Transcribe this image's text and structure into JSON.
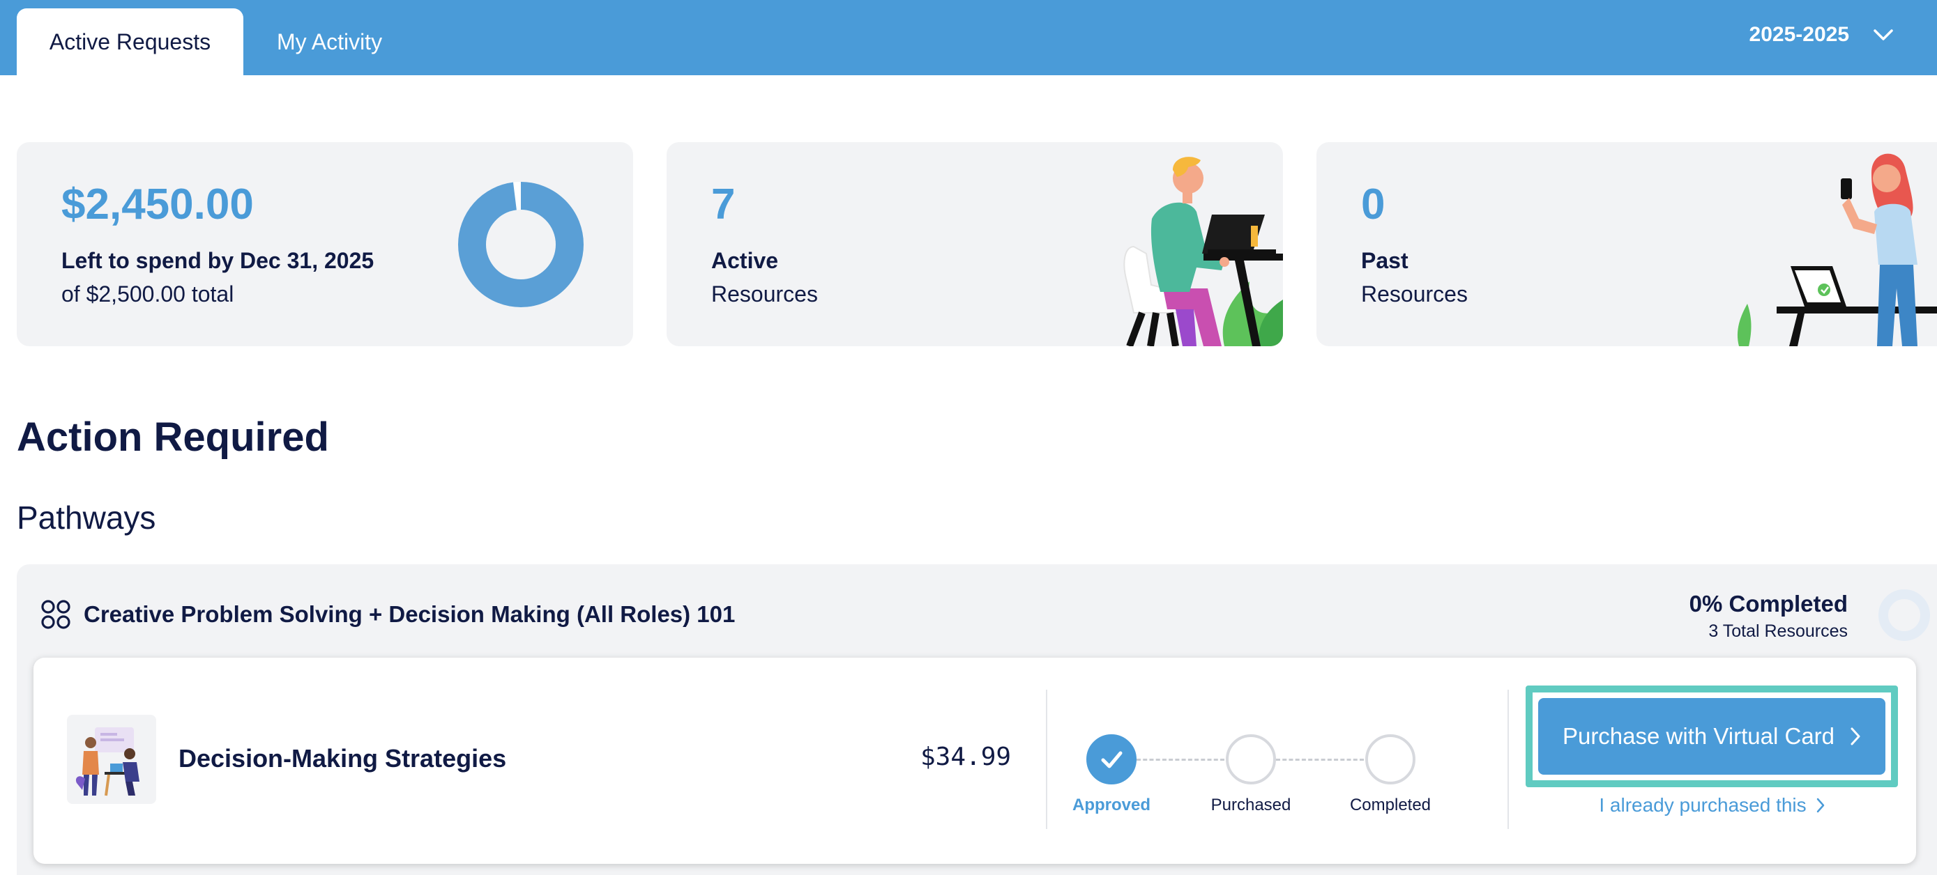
{
  "tabs": [
    {
      "label": "Active Requests",
      "active": true
    },
    {
      "label": "My Activity",
      "active": false
    }
  ],
  "year_select": {
    "value": "2025-2025",
    "icon": "chevron-down-icon"
  },
  "stats": {
    "budget": {
      "amount": "$2,450.00",
      "label": "Left to spend by Dec 31, 2025",
      "sublabel": "of $2,500.00 total",
      "remaining_fraction": 0.98
    },
    "active": {
      "count": "7",
      "label": "Active",
      "sublabel": "Resources"
    },
    "past": {
      "count": "0",
      "label": "Past",
      "sublabel": "Resources"
    }
  },
  "headings": {
    "action_required": "Action Required",
    "pathways": "Pathways"
  },
  "pathway": {
    "icon": "grid-circles-icon",
    "title": "Creative Problem Solving + Decision Making (All Roles) 101",
    "completed": "0% Completed",
    "total": "3 Total Resources",
    "progress_fraction": 0,
    "resource": {
      "title": "Decision-Making Strategies",
      "price": "$34.99",
      "steps": [
        {
          "label": "Approved",
          "done": true
        },
        {
          "label": "Purchased",
          "done": false
        },
        {
          "label": "Completed",
          "done": false
        }
      ],
      "primary_action": "Purchase with Virtual Card",
      "secondary_action": "I already purchased this"
    }
  },
  "colors": {
    "accent": "#4a9bd8",
    "text": "#101a44",
    "card_bg": "#f2f3f5",
    "highlight": "#60cbc1"
  }
}
